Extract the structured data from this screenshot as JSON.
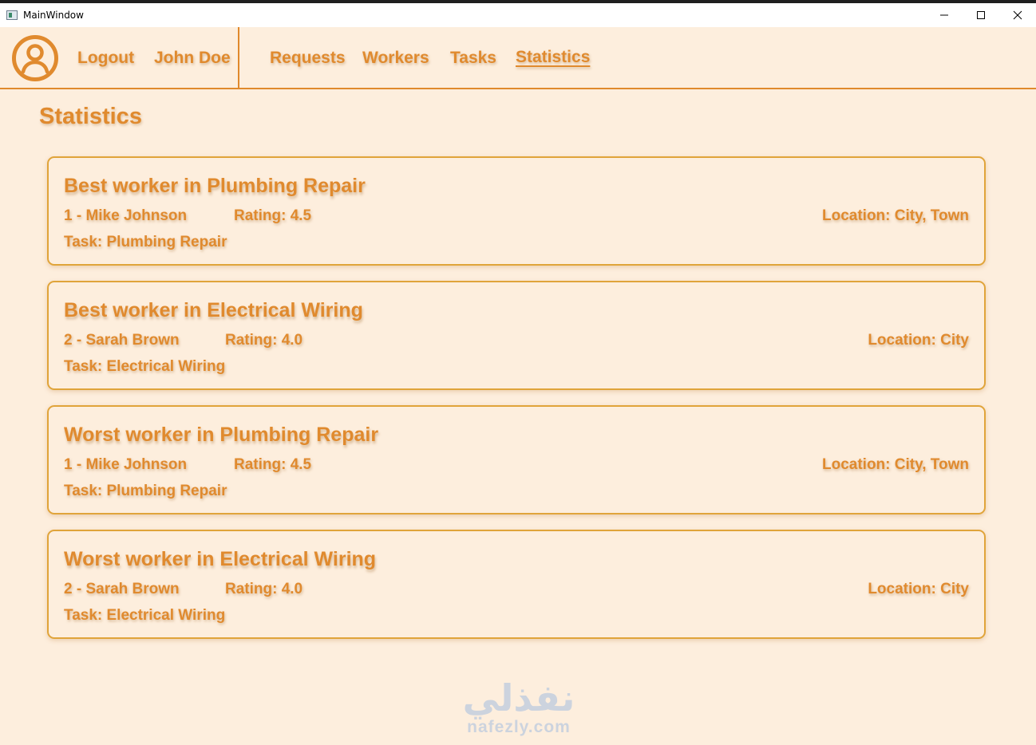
{
  "window": {
    "title": "MainWindow"
  },
  "nav": {
    "logout": "Logout",
    "user_name": "John Doe",
    "links": [
      "Requests",
      "Workers",
      "Tasks",
      "Statistics"
    ],
    "active": "Statistics"
  },
  "page": {
    "title": "Statistics"
  },
  "cards": [
    {
      "title": "Best worker in Plumbing Repair",
      "worker": "1 - Mike Johnson",
      "rating": "Rating: 4.5",
      "location": "Location: City, Town",
      "task": "Task: Plumbing Repair"
    },
    {
      "title": "Best worker in Electrical Wiring",
      "worker": "2 - Sarah Brown",
      "rating": "Rating: 4.0",
      "location": "Location: City",
      "task": "Task: Electrical Wiring"
    },
    {
      "title": "Worst worker in Plumbing Repair",
      "worker": "1 - Mike Johnson",
      "rating": "Rating: 4.5",
      "location": "Location: City, Town",
      "task": "Task: Plumbing Repair"
    },
    {
      "title": "Worst worker in Electrical Wiring",
      "worker": "2 - Sarah Brown",
      "rating": "Rating: 4.0",
      "location": "Location: City",
      "task": "Task: Electrical Wiring"
    }
  ],
  "watermark": {
    "arabic": "نفذلي",
    "latin": "nafezly.com"
  },
  "colors": {
    "accent": "#e08a2e",
    "background": "#fdeedd",
    "card_border": "#e0a43a"
  },
  "icons": {
    "avatar": "user-circle-icon",
    "minimize": "minimize-icon",
    "maximize": "maximize-icon",
    "close": "close-icon"
  }
}
